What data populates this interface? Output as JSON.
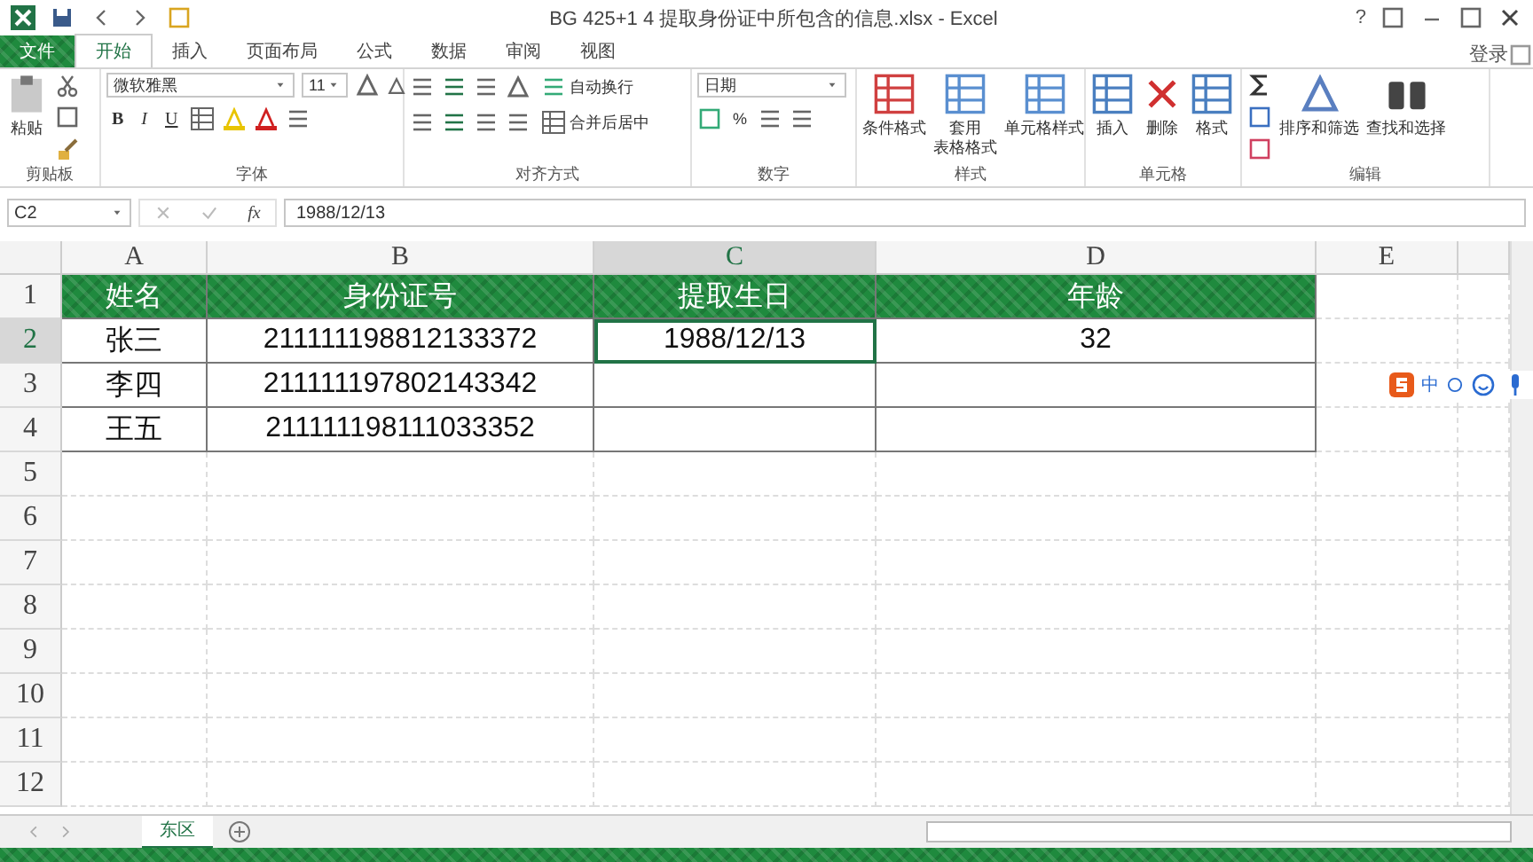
{
  "window": {
    "title": "BG 425+1 4 提取身份证中所包含的信息.xlsx - Excel",
    "help": "?",
    "login": "登录"
  },
  "tabs": [
    {
      "label": "文件",
      "kind": "file",
      "selected": false
    },
    {
      "label": "开始",
      "kind": "tab",
      "selected": true
    },
    {
      "label": "插入",
      "kind": "tab",
      "selected": false
    },
    {
      "label": "页面布局",
      "kind": "tab",
      "selected": false
    },
    {
      "label": "公式",
      "kind": "tab",
      "selected": false
    },
    {
      "label": "数据",
      "kind": "tab",
      "selected": false
    },
    {
      "label": "审阅",
      "kind": "tab",
      "selected": false
    },
    {
      "label": "视图",
      "kind": "tab",
      "selected": false
    }
  ],
  "ribbon": {
    "groups": [
      {
        "kind": "clipboard",
        "label": "剪贴板",
        "paste": "粘贴"
      },
      {
        "kind": "font",
        "label": "字体",
        "font": "微软雅黑",
        "size": "11",
        "styles": [
          "B",
          "I",
          "U"
        ]
      },
      {
        "kind": "alignment",
        "label": "对齐方式",
        "wrap": "自动换行",
        "merge": "合并后居中"
      },
      {
        "kind": "number",
        "label": "数字",
        "format": "日期",
        "percent": "%"
      },
      {
        "kind": "styles",
        "label": "样式",
        "buttons": [
          [
            "条件格式"
          ],
          [
            "套用",
            "表格格式"
          ],
          [
            "单元格样式"
          ]
        ]
      },
      {
        "kind": "cells",
        "label": "单元格",
        "buttons": [
          "插入",
          "删除",
          "格式"
        ]
      },
      {
        "kind": "editing",
        "label": "编辑",
        "buttons": [
          "排序和筛选",
          "查找和选择"
        ]
      }
    ]
  },
  "formula_bar": {
    "name_box": "C2",
    "fx": "fx",
    "value": "1988/12/13"
  },
  "sheet": {
    "columns": [
      {
        "label": "A",
        "selected": false
      },
      {
        "label": "B",
        "selected": false
      },
      {
        "label": "C",
        "selected": true
      },
      {
        "label": "D",
        "selected": false
      },
      {
        "label": "E",
        "selected": false
      }
    ],
    "rows": [
      {
        "label": "1",
        "kind": "header",
        "selected": false,
        "cells": [
          {
            "text": "姓名",
            "selected": false
          },
          {
            "text": "身份证号",
            "selected": false
          },
          {
            "text": "提取生日",
            "selected": false
          },
          {
            "text": "年龄",
            "selected": false
          }
        ]
      },
      {
        "label": "2",
        "kind": "data",
        "selected": true,
        "cells": [
          {
            "text": "张三",
            "selected": false
          },
          {
            "text": "211111198812133372",
            "selected": false
          },
          {
            "text": "1988/12/13",
            "selected": true
          },
          {
            "text": "32",
            "selected": false
          }
        ]
      },
      {
        "label": "3",
        "kind": "data",
        "selected": false,
        "cells": [
          {
            "text": "李四",
            "selected": false
          },
          {
            "text": "211111197802143342",
            "selected": false
          },
          {
            "selected": false
          },
          {
            "selected": false
          }
        ]
      },
      {
        "label": "4",
        "kind": "data",
        "selected": false,
        "cells": [
          {
            "text": "王五",
            "selected": false
          },
          {
            "text": "211111198111033352",
            "selected": false
          },
          {
            "selected": false
          },
          {
            "selected": false
          }
        ]
      },
      {
        "label": "5",
        "kind": "blank",
        "selected": false
      },
      {
        "label": "6",
        "kind": "blank",
        "selected": false
      },
      {
        "label": "7",
        "kind": "blank",
        "selected": false
      },
      {
        "label": "8",
        "kind": "blank",
        "selected": false
      },
      {
        "label": "9",
        "kind": "blank",
        "selected": false
      },
      {
        "label": "10",
        "kind": "blank",
        "selected": false
      },
      {
        "label": "11",
        "kind": "blank",
        "selected": false
      },
      {
        "label": "12",
        "kind": "blank",
        "selected": false
      }
    ]
  },
  "ime_bar": {
    "mode": "中"
  },
  "sheet_tabs": [
    {
      "label": "东区",
      "selected": true
    }
  ]
}
